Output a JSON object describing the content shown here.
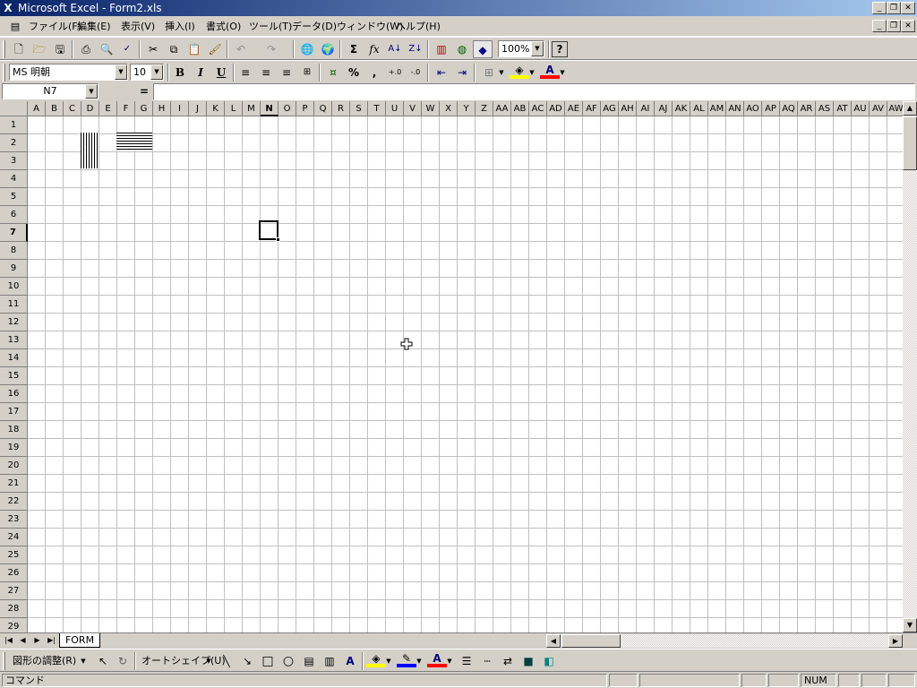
{
  "window": {
    "title": "Microsoft Excel - Form2.xls"
  },
  "menu": [
    "ファイル(F)",
    "編集(E)",
    "表示(V)",
    "挿入(I)",
    "書式(O)",
    "ツール(T)",
    "データ(D)",
    "ウィンドウ(W)",
    "ヘルプ(H)"
  ],
  "toolbar": {
    "zoom": "100%"
  },
  "format": {
    "font": "MS 明朝",
    "size": "10",
    "bold": "B",
    "italic": "I",
    "underline": "U",
    "percent": "%",
    "comma": ","
  },
  "formula": {
    "namebox": "N7",
    "eq": "=",
    "value": ""
  },
  "columns": [
    "A",
    "B",
    "C",
    "D",
    "E",
    "F",
    "G",
    "H",
    "I",
    "J",
    "K",
    "L",
    "M",
    "N",
    "O",
    "P",
    "Q",
    "R",
    "S",
    "T",
    "U",
    "V",
    "W",
    "X",
    "Y",
    "Z",
    "AA",
    "AB",
    "AC",
    "AD",
    "AE",
    "AF",
    "AG",
    "AH",
    "AI",
    "AJ",
    "AK",
    "AL",
    "AM",
    "AN",
    "AO",
    "AP",
    "AQ",
    "AR",
    "AS",
    "AT",
    "AU",
    "AV",
    "AW"
  ],
  "rows": [
    "1",
    "2",
    "3",
    "4",
    "5",
    "6",
    "7",
    "8",
    "9",
    "10",
    "11",
    "12",
    "13",
    "14",
    "15",
    "16",
    "17",
    "18",
    "19",
    "20",
    "21",
    "22",
    "23",
    "24",
    "25",
    "26",
    "27",
    "28",
    "29"
  ],
  "selected": {
    "col": "N",
    "row": "7"
  },
  "sheet": {
    "tab": "FORM"
  },
  "draw": {
    "adjust": "図形の調整(R)",
    "autoshape": "オートシェイプ(U)"
  },
  "status": {
    "mode": "コマンド",
    "num": "NUM"
  },
  "colors": {
    "title_start": "#0a246a",
    "title_end": "#a6caf0",
    "fill": "#ffff00",
    "font": "#ff0000",
    "line": "#0000ff"
  },
  "icons": [
    "new-icon",
    "open-icon",
    "save-icon",
    "print-icon",
    "preview-icon",
    "spell-icon",
    "cut-icon",
    "copy-icon",
    "paste-icon",
    "format-painter-icon",
    "undo-icon",
    "redo-icon",
    "hyperlink-icon",
    "web-icon",
    "autosum-icon",
    "function-icon",
    "sort-asc-icon",
    "sort-desc-icon",
    "chart-icon",
    "map-icon",
    "drawing-icon",
    "help-icon"
  ]
}
